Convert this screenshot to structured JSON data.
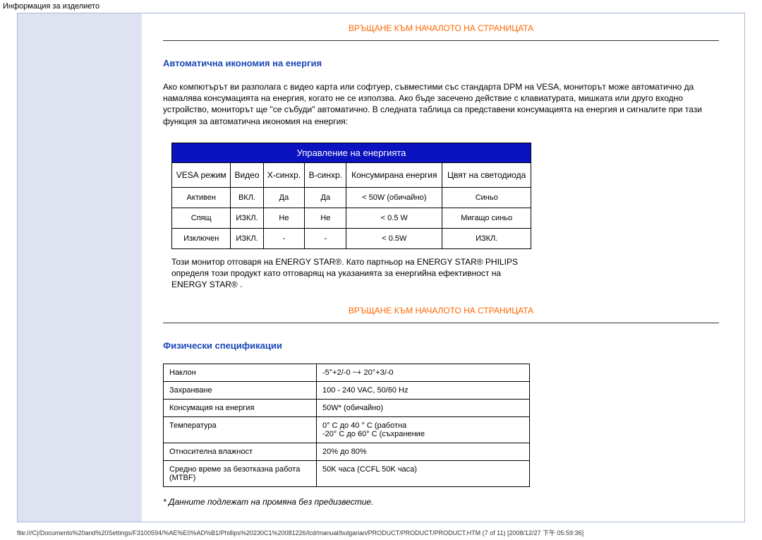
{
  "page_header": "Информация за изделието",
  "links": {
    "back_to_top": "ВРЪЩАНЕ КЪМ НАЧАЛОТО НА СТРАНИЦАТА"
  },
  "energy_section": {
    "heading": "Автоматична икономия на енергия",
    "paragraph": "Ако компютърът ви разполага с видео карта или софтуер, съвместими със стандарта DPM на VESA, мониторът може автоматично да намалява консумацията на енергия, когато не се използва. Ако бъде засечено действие с клавиатурата, мишката или друго входно устройство, мониторът ще \"се събуди\" автоматично. В следната таблица са представени консумацията на енергия и сигналите при тази функция за автоматична икономия на енергия:",
    "table_caption": "Управление на енергията",
    "columns": [
      "VESA режим",
      "Видео",
      "Х-синхр.",
      "В-синхр.",
      "Консумирана енергия",
      "Цвят на светодиода"
    ],
    "rows": [
      [
        "Активен",
        "ВКЛ.",
        "Да",
        "Да",
        "< 50W (обичайно)",
        "Синьо"
      ],
      [
        "Спящ",
        "ИЗКЛ.",
        "Не",
        "Не",
        "< 0.5 W",
        "Мигащо синьо"
      ],
      [
        "Изключен",
        "ИЗКЛ.",
        "-",
        "-",
        "< 0.5W",
        "ИЗКЛ."
      ]
    ],
    "note": "Този монитор отговаря на ENERGY STAR®. Като партньор на ENERGY STAR® PHILIPS определя този продукт като отговарящ на указанията за енергийна ефективност на ENERGY STAR® ."
  },
  "physical_section": {
    "heading": "Физически спецификации",
    "rows": [
      {
        "label": "Наклон",
        "value": "-5°+2/-0 ~+ 20°+3/-0"
      },
      {
        "label": "Захранване",
        "value": "100 - 240 VAC, 50/60 Hz"
      },
      {
        "label": "Консумация на енергия",
        "value": "50W* (обичайно)"
      },
      {
        "label": "Температура",
        "value": "0° C до 40 ° C (работна\n-20° C до 60° C (съхранение"
      },
      {
        "label": "Относителна влажност",
        "value": "20% до 80%"
      },
      {
        "label": "  Средно време за безотказна работа (MTBF)",
        "value": "50K часа (CCFL 50K часа)"
      }
    ],
    "footnote": "* Данните подлежат на промяна без предизвестие."
  },
  "footer_url": "file:///C|/Documents%20and%20Settings/F3100594/%AE%E0%AD%B1/Phillips%20230C1%20081226/lcd/manual/bulgarian/PRODUCT/PRODUCT/PRODUCT.HTM (7 of 11) [2008/12/27 下午 05:59:36]"
}
